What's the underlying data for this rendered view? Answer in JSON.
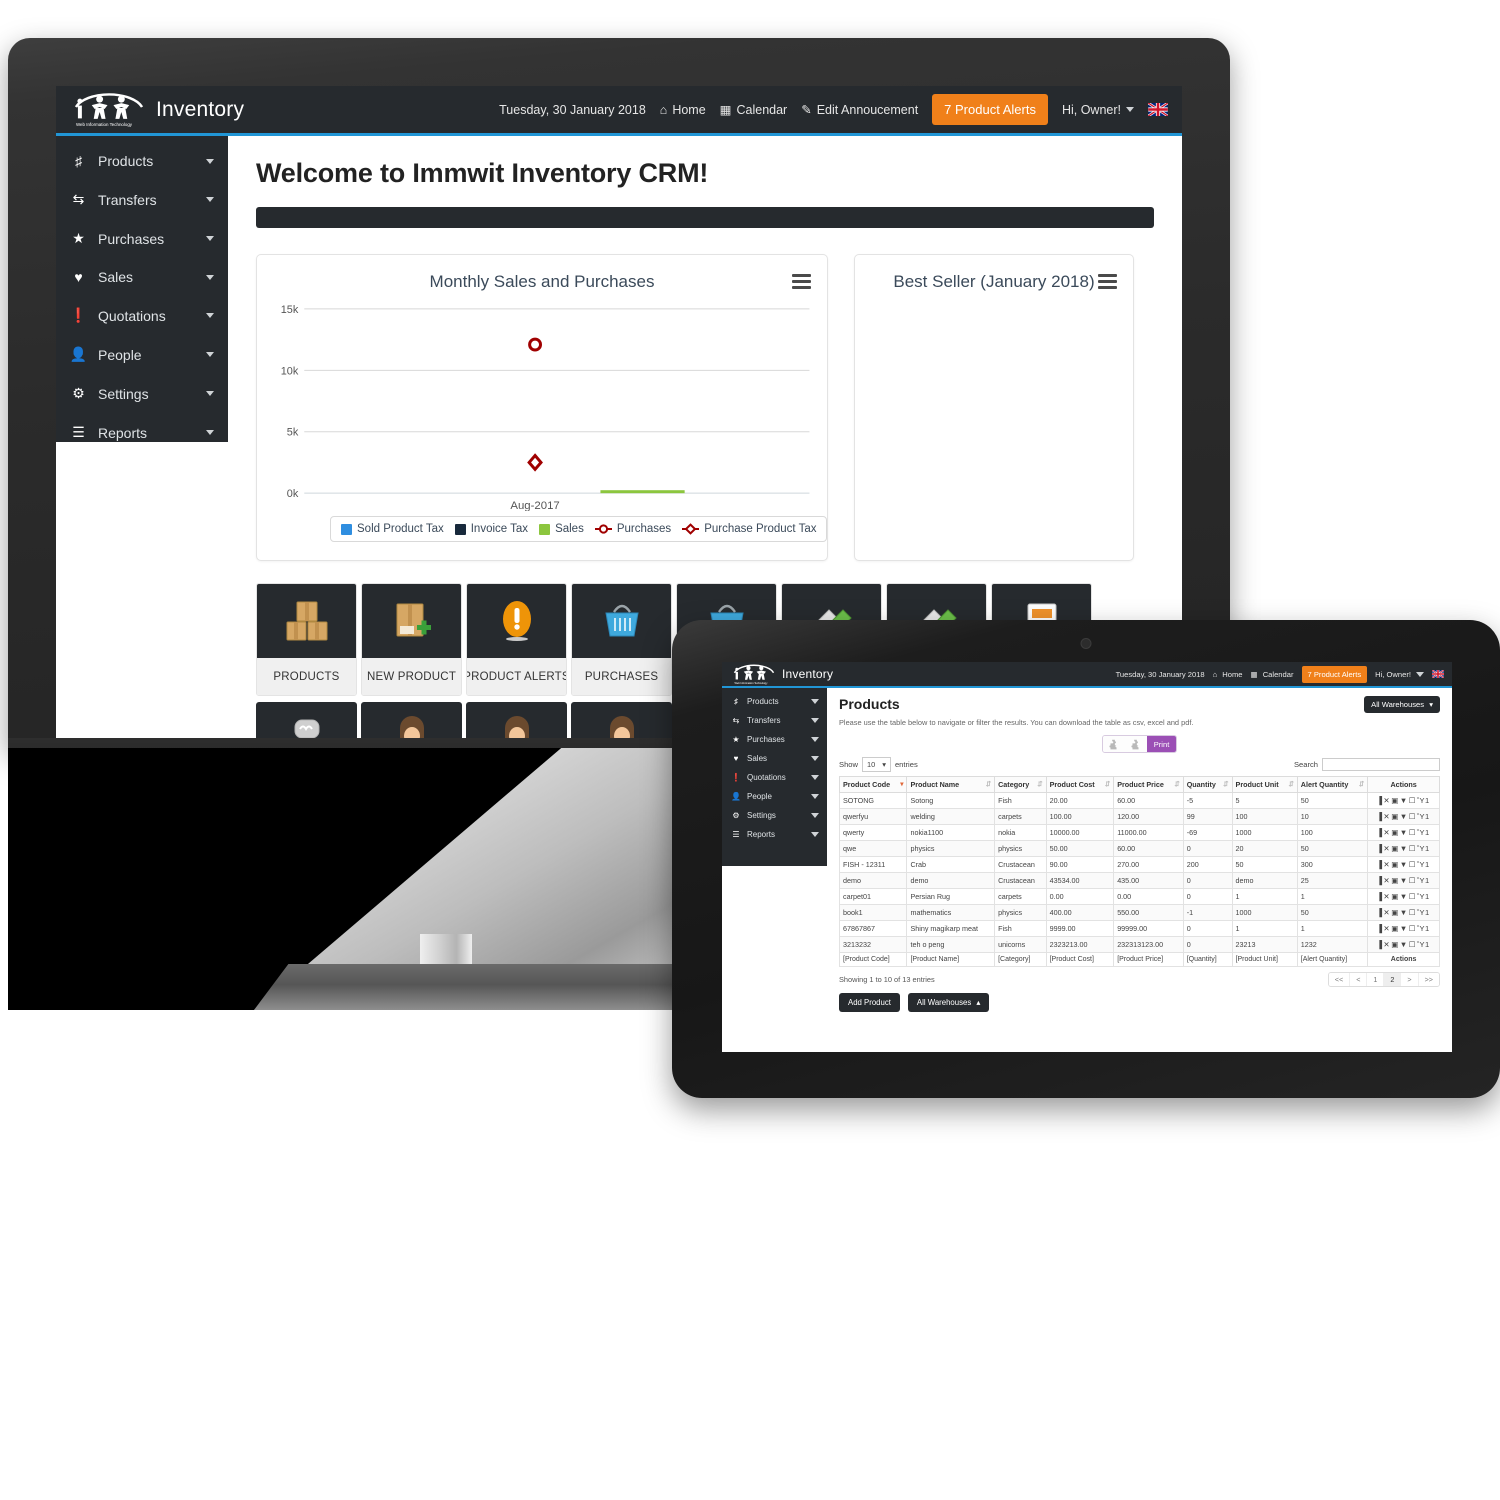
{
  "brand": {
    "name": "Inventory",
    "tagline": "Web Information Technology"
  },
  "topnav": {
    "date": "Tuesday, 30 January 2018",
    "home": "Home",
    "calendar": "Calendar",
    "edit_announcement": "Edit Annoucement",
    "alerts": "7 Product Alerts",
    "user": "Hi, Owner!",
    "accent_orange": "#f0801a",
    "accent_blue": "#2196d6",
    "bar_dark": "#262a2e"
  },
  "sidebar": {
    "items": [
      {
        "label": "Products",
        "icon": "books-icon"
      },
      {
        "label": "Transfers",
        "icon": "shuffle-icon"
      },
      {
        "label": "Purchases",
        "icon": "star-icon"
      },
      {
        "label": "Sales",
        "icon": "heart-icon"
      },
      {
        "label": "Quotations",
        "icon": "exclamation-circle-icon"
      },
      {
        "label": "People",
        "icon": "user-icon"
      },
      {
        "label": "Settings",
        "icon": "gear-icon"
      },
      {
        "label": "Reports",
        "icon": "list-icon"
      }
    ]
  },
  "dashboard": {
    "welcome": "Welcome to Immwit Inventory CRM!",
    "best_seller_title": "Best Seller (January 2018)",
    "tiles": [
      {
        "label": "PRODUCTS",
        "icon": "boxes-icon"
      },
      {
        "label": "NEW PRODUCT",
        "icon": "box-plus-icon"
      },
      {
        "label": "PRODUCT ALERTS",
        "icon": "alert-icon"
      },
      {
        "label": "PURCHASES",
        "icon": "basket-icon"
      }
    ]
  },
  "chart_data": {
    "type": "bar",
    "title": "Monthly Sales and Purchases",
    "categories": [
      "Aug-2017"
    ],
    "xlabel": "",
    "ylabel": "",
    "ylim": [
      0,
      15000
    ],
    "ytick_labels": [
      "0k",
      "5k",
      "10k",
      "15k"
    ],
    "ytick_values": [
      0,
      5000,
      10000,
      15000
    ],
    "grid": true,
    "legend_position": "bottom",
    "series": [
      {
        "name": "Sold Product Tax",
        "type": "bar",
        "color": "#2f8ee0",
        "values": [
          0
        ]
      },
      {
        "name": "Invoice Tax",
        "type": "bar",
        "color": "#18293c",
        "values": [
          0
        ]
      },
      {
        "name": "Sales",
        "type": "bar",
        "color": "#8cc63e",
        "values": [
          110
        ]
      },
      {
        "name": "Purchases",
        "type": "marker",
        "color": "#a00000",
        "marker": "circle",
        "values": [
          12050
        ]
      },
      {
        "name": "Purchase Product Tax",
        "type": "marker",
        "color": "#a00000",
        "marker": "diamond",
        "values": [
          2480
        ]
      }
    ]
  },
  "tablet": {
    "page_title": "Products",
    "subtitle": "Please use the table below to navigate or filter the results. You can download the table as csv, excel and pdf.",
    "warehouse_selector": "All Warehouses",
    "export": {
      "print": "Print"
    },
    "show_label": "Show",
    "show_value": "10",
    "entries_label": "entries",
    "search_label": "Search",
    "search_value": "",
    "columns": [
      "Product Code",
      "Product Name",
      "Category",
      "Product Cost",
      "Product Price",
      "Quantity",
      "Product Unit",
      "Alert Quantity",
      "Actions"
    ],
    "rows": [
      [
        "SOTONG",
        "Sotong",
        "Fish",
        "20.00",
        "60.00",
        "-5",
        "5",
        "50"
      ],
      [
        "qwerfyu",
        "welding",
        "carpets",
        "100.00",
        "120.00",
        "99",
        "100",
        "10"
      ],
      [
        "qwerty",
        "nokia1100",
        "nokia",
        "10000.00",
        "11000.00",
        "-69",
        "1000",
        "100"
      ],
      [
        "qwe",
        "physics",
        "physics",
        "50.00",
        "60.00",
        "0",
        "20",
        "50"
      ],
      [
        "FISH - 12311",
        "Crab",
        "Crustacean",
        "90.00",
        "270.00",
        "200",
        "50",
        "300"
      ],
      [
        "demo",
        "demo",
        "Crustacean",
        "43534.00",
        "435.00",
        "0",
        "demo",
        "25"
      ],
      [
        "carpet01",
        "Persian Rug",
        "carpets",
        "0.00",
        "0.00",
        "0",
        "1",
        "1"
      ],
      [
        "book1",
        "mathematics",
        "physics",
        "400.00",
        "550.00",
        "-1",
        "1000",
        "50"
      ],
      [
        "67867867",
        "Shiny magikarp meat",
        "Fish",
        "9999.00",
        "99999.00",
        "0",
        "1",
        "1"
      ],
      [
        "3213232",
        "teh o peng",
        "unicorns",
        "2323213.00",
        "232313123.00",
        "0",
        "23213",
        "1232"
      ]
    ],
    "footer_filters": [
      "[Product Code]",
      "[Product Name]",
      "[Category]",
      "[Product Cost]",
      "[Product Price]",
      "[Quantity]",
      "[Product Unit]",
      "[Alert Quantity]",
      "Actions"
    ],
    "showing": "Showing 1 to 10 of 13 entries",
    "pager": [
      "<<",
      "<",
      "1",
      "2",
      ">",
      ">>"
    ],
    "pager_active": "2",
    "add_product": "Add Product",
    "warehouse_bottom": "All Warehouses"
  }
}
